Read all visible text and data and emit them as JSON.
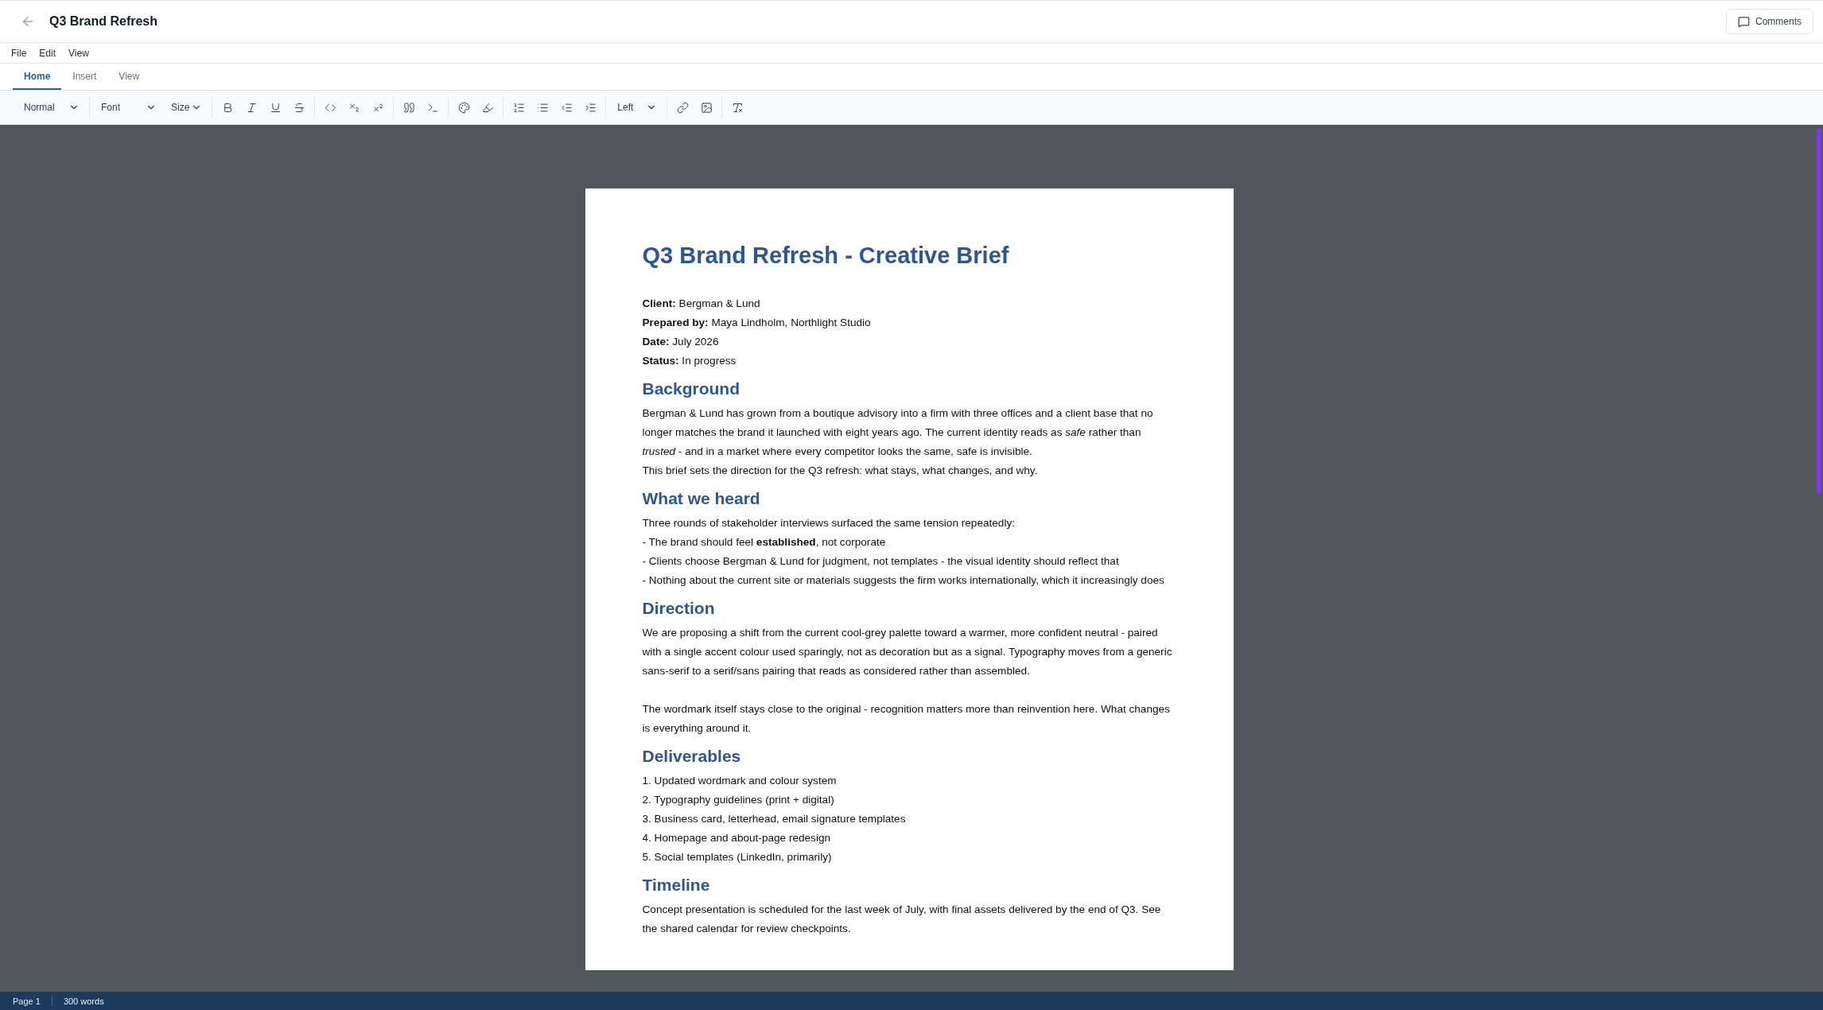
{
  "header": {
    "title": "Q3 Brand Refresh",
    "comments_button": "Comments"
  },
  "menu": [
    "File",
    "Edit",
    "View"
  ],
  "tabs": [
    {
      "label": "Home",
      "selected": true
    },
    {
      "label": "Insert",
      "selected": false
    },
    {
      "label": "View",
      "selected": false
    }
  ],
  "toolbar": [
    [
      {
        "kind": "select",
        "label": "Normal"
      }
    ],
    [
      {
        "kind": "select",
        "label": "Font"
      },
      {
        "kind": "select",
        "label": "Size"
      }
    ],
    [
      {
        "kind": "bold"
      },
      {
        "kind": "italic"
      },
      {
        "kind": "underline"
      },
      {
        "kind": "strike"
      }
    ],
    [
      {
        "kind": "code"
      },
      {
        "kind": "subscript"
      },
      {
        "kind": "superscript"
      }
    ],
    [
      {
        "kind": "quote"
      },
      {
        "kind": "terminal"
      }
    ],
    [
      {
        "kind": "palette"
      },
      {
        "kind": "highlighter"
      }
    ],
    [
      {
        "kind": "ordered"
      },
      {
        "kind": "bullets"
      },
      {
        "kind": "outdent"
      },
      {
        "kind": "indent"
      }
    ],
    [
      {
        "kind": "select",
        "label": "Left"
      }
    ],
    [
      {
        "kind": "link"
      },
      {
        "kind": "image"
      }
    ],
    [
      {
        "kind": "clear"
      }
    ]
  ],
  "document": {
    "title": "Q3 Brand Refresh - Creative Brief",
    "meta": [
      {
        "label": "Client:",
        "value": "Bergman & Lund"
      },
      {
        "label": "Prepared by:",
        "value": "Maya Lindholm, Northlight Studio"
      },
      {
        "label": "Date:",
        "value": "July 2026"
      },
      {
        "label": "Status:",
        "value": "In progress"
      }
    ],
    "sections": [
      {
        "heading": "Background",
        "paragraphs": [
          [
            "Bergman & Lund has grown from a boutique advisory into a firm with three offices and a client base that no longer matches the brand it launched with eight years ago. The current identity reads as *safe* rather than *trusted* - and in a market where every competitor looks the same, safe is invisible.",
            "This brief sets the direction for the Q3 refresh: what stays, what changes, and why."
          ]
        ]
      },
      {
        "heading": "What we heard",
        "paragraphs": [
          [
            "Three rounds of stakeholder interviews surfaced the same tension repeatedly:",
            "- The brand should feel **established**, not corporate",
            "- Clients choose Bergman & Lund for judgment, not templates - the visual identity should reflect that",
            "- Nothing about the current site or materials suggests the firm works internationally, which it increasingly does"
          ]
        ]
      },
      {
        "heading": "Direction",
        "paragraphs": [
          [
            "We are proposing a shift from the current cool-grey palette toward a warmer, more confident neutral - paired with a single accent colour used sparingly, not as decoration but as a signal. Typography moves from a generic sans-serif to a serif/sans pairing that reads as considered rather than assembled."
          ],
          [
            "The wordmark itself stays close to the original - recognition matters more than reinvention here. What changes is everything around it."
          ]
        ]
      },
      {
        "heading": "Deliverables",
        "paragraphs": [
          [
            "1. Updated wordmark and colour system",
            "2. Typography guidelines (print + digital)",
            "3. Business card, letterhead, email signature templates",
            "4. Homepage and about-page redesign",
            "5. Social templates (LinkedIn, primarily)"
          ]
        ]
      },
      {
        "heading": "Timeline",
        "paragraphs": [
          [
            "Concept presentation is scheduled for the last week of July, with final assets delivered by the end of Q3. See the shared calendar for review checkpoints."
          ]
        ]
      }
    ]
  },
  "status_bar": {
    "page": "Page 1",
    "words": "300 words"
  }
}
